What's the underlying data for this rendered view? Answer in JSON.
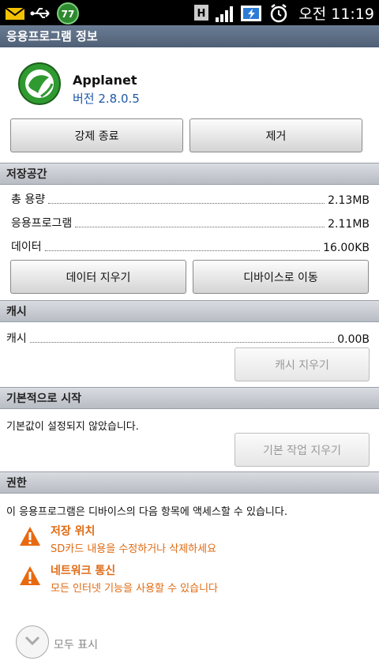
{
  "status_bar": {
    "time": "오전 11:19",
    "battery_level": "77"
  },
  "title": "응용프로그램 정보",
  "app": {
    "name": "Applanet",
    "version": "버전 2.8.0.5"
  },
  "buttons": {
    "force_stop": "강제 종료",
    "uninstall": "제거"
  },
  "storage": {
    "header": "저장공간",
    "rows": [
      {
        "label": "총 용량",
        "value": "2.13MB"
      },
      {
        "label": "응용프로그램",
        "value": "2.11MB"
      },
      {
        "label": "데이터",
        "value": "16.00KB"
      }
    ],
    "clear_data": "데이터 지우기",
    "move_to_device": "디바이스로 이동"
  },
  "cache": {
    "header": "캐시",
    "label": "캐시",
    "value": "0.00B",
    "clear_cache": "캐시 지우기"
  },
  "launch_default": {
    "header": "기본적으로 시작",
    "text": "기본값이 설정되지 않았습니다.",
    "clear_defaults": "기본 작업 지우기"
  },
  "permissions": {
    "header": "권한",
    "intro": "이 응용프로그램은 디바이스의 다음 항목에 액세스할 수 있습니다.",
    "items": [
      {
        "title": "저장 위치",
        "desc": "SD카드 내용을 수정하거나 삭제하세요"
      },
      {
        "title": "네트워크 통신",
        "desc": "모든 인터넷 기능을 사용할 수 있습니다"
      }
    ],
    "show_all": "모두 표시"
  },
  "colors": {
    "title_bar": "#5a6b82",
    "warning": "#e06a12",
    "version": "#1e58a8"
  }
}
